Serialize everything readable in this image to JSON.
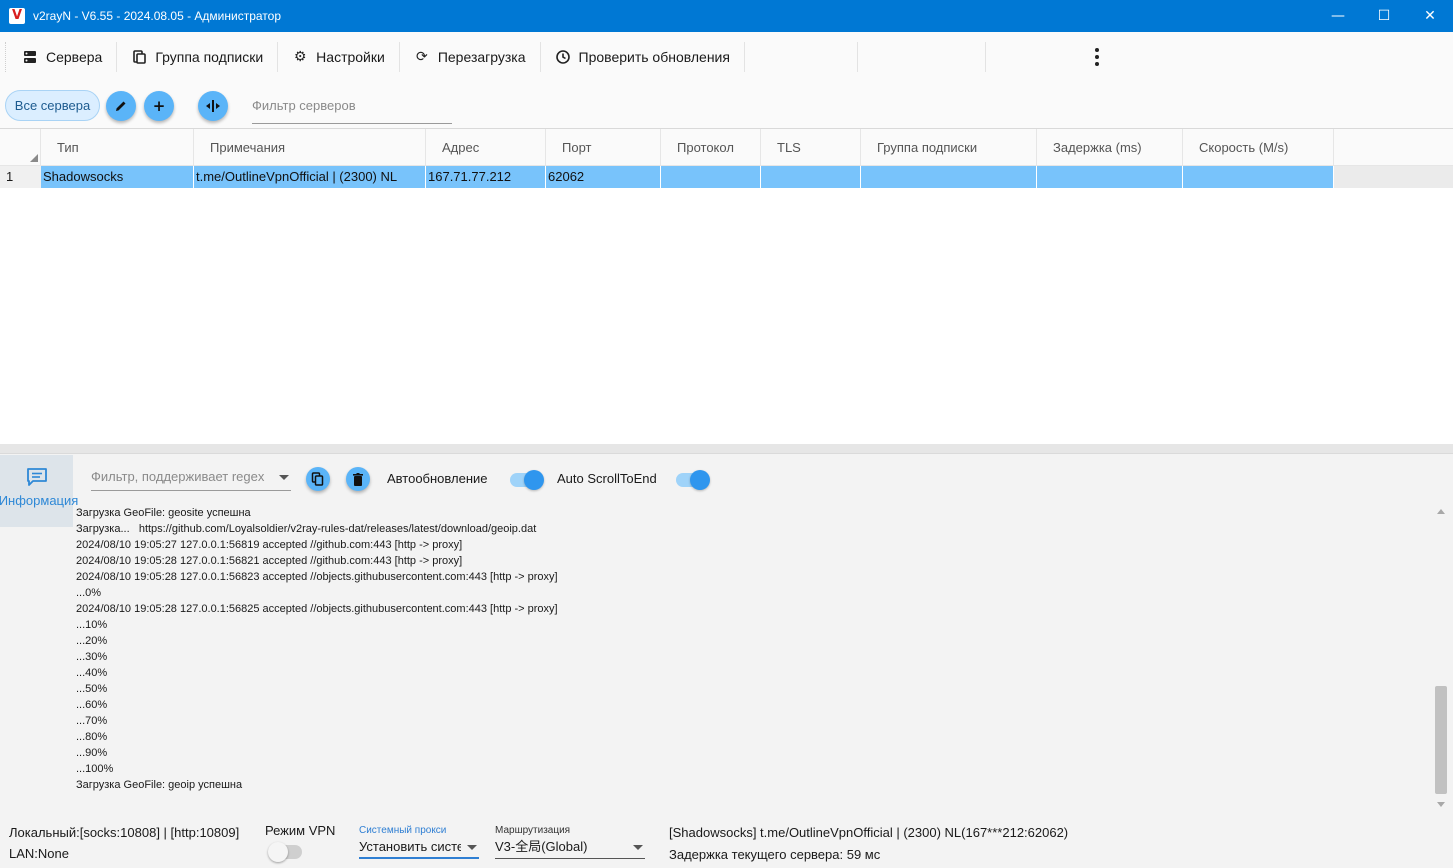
{
  "window": {
    "title": "v2rayN - V6.55 - 2024.08.05 - Администратор",
    "app_icon": "V",
    "minimize": "—",
    "maximize": "☐",
    "close": "✕"
  },
  "menu": {
    "items": [
      {
        "label": "Сервера",
        "icon": "server-icon"
      },
      {
        "label": "Группа подписки",
        "icon": "subscription-icon"
      },
      {
        "label": "Настройки",
        "icon": "gear-icon"
      },
      {
        "label": "Перезагрузка",
        "icon": "reload-icon"
      },
      {
        "label": "Проверить обновления",
        "icon": "update-icon"
      }
    ],
    "more_icon": "more-vertical-icon"
  },
  "server_toolbar": {
    "all_servers_label": "Все сервера",
    "filter_placeholder": "Фильтр серверов"
  },
  "grid": {
    "columns": [
      "Тип",
      "Примечания",
      "Адрес",
      "Порт",
      "Протокол",
      "TLS",
      "Группа подписки",
      "Задержка (ms)",
      "Скорость (M/s)"
    ],
    "rows": [
      {
        "num": "1",
        "type": "Shadowsocks",
        "remarks": "t.me/OutlineVpnOfficial | (2300) NL",
        "address": "167.71.77.212",
        "port": "62062",
        "protocol": "",
        "tls": "",
        "sub_group": "",
        "delay": "",
        "speed": ""
      }
    ]
  },
  "info_panel": {
    "tab_label": "Информация",
    "regex_placeholder": "Фильтр, поддерживает regex",
    "auto_update_label": "Автообновление",
    "auto_scroll_label": "Auto ScrollToEnd",
    "auto_update_on": true,
    "auto_scroll_on": true
  },
  "log": [
    "Загрузка GeoFile: geosite успешна",
    "Загрузка...   https://github.com/Loyalsoldier/v2ray-rules-dat/releases/latest/download/geoip.dat",
    "2024/08/10 19:05:27 127.0.0.1:56819 accepted //github.com:443 [http -> proxy]",
    "2024/08/10 19:05:28 127.0.0.1:56821 accepted //github.com:443 [http -> proxy]",
    "2024/08/10 19:05:28 127.0.0.1:56823 accepted //objects.githubusercontent.com:443 [http -> proxy]",
    "...0%",
    "2024/08/10 19:05:28 127.0.0.1:56825 accepted //objects.githubusercontent.com:443 [http -> proxy]",
    "...10%",
    "...20%",
    "...30%",
    "...40%",
    "...50%",
    "...60%",
    "...70%",
    "...80%",
    "...90%",
    "...100%",
    "Загрузка GeoFile: geoip успешна"
  ],
  "status": {
    "local": "Локальный:[socks:10808] | [http:10809]",
    "lan": "LAN:None",
    "vpn_mode_label": "Режим VPN",
    "vpn_on": false,
    "sys_proxy_label": "Системный прокси",
    "sys_proxy_value": "Установить системный прокси",
    "routing_label": "Маршрутизация",
    "routing_value": "V3-全局(Global)",
    "current_server": "[Shadowsocks] t.me/OutlineVpnOfficial | (2300) NL(167***212:62062)",
    "current_delay": "Задержка текущего сервера: 59 мс"
  },
  "colors": {
    "titlebar": "#0078d4",
    "accent": "#2f96ee",
    "selected_row": "#78c3fb",
    "fab": "#5ab4f8"
  }
}
